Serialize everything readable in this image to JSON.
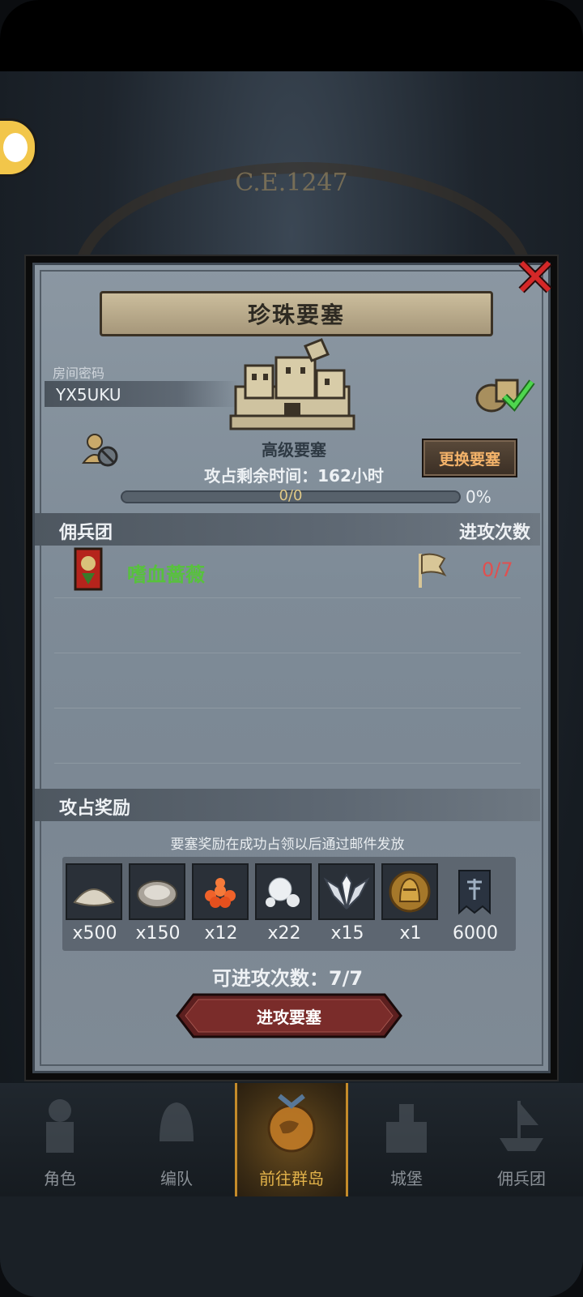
{
  "background": {
    "era_label": "C.E.1247"
  },
  "modal": {
    "title": "珍珠要塞",
    "room_password_label": "房间密码",
    "room_code": "YX5UKU",
    "fort_type": "高级要塞",
    "change_fort_button": "更换要塞",
    "remaining_time_label": "攻占剩余时间：",
    "remaining_time_value": "162",
    "remaining_time_unit": "小时",
    "progress_text": "0/0",
    "progress_percent": "0%",
    "progress_fraction": 0,
    "mercenary_section": {
      "title": "佣兵团",
      "attack_count_header": "进攻次数",
      "rows": [
        {
          "name": "嗜血蔷薇",
          "attacks": "0/7"
        }
      ]
    },
    "reward_section": {
      "title": "攻占奖励",
      "note": "要塞奖励在成功占领以后通过邮件发放",
      "items": [
        {
          "icon": "stone-pile-icon",
          "qty": "x500"
        },
        {
          "icon": "oyster-icon",
          "qty": "x150"
        },
        {
          "icon": "fish-roe-icon",
          "qty": "x12"
        },
        {
          "icon": "pearl-icon",
          "qty": "x22"
        },
        {
          "icon": "winged-emblem-icon",
          "qty": "x15"
        },
        {
          "icon": "knight-helmet-medal-icon",
          "qty": "x1"
        },
        {
          "icon": "guild-banner-icon",
          "qty": "6000"
        }
      ]
    },
    "attempts_label": "可进攻次数：",
    "attempts_value": "7/7",
    "attack_button": "进攻要塞"
  },
  "bottom_nav": [
    {
      "label": "角色",
      "icon": "knight-icon"
    },
    {
      "label": "编队",
      "icon": "helmet-icon"
    },
    {
      "label": "前往群岛",
      "icon": "island-globe-icon",
      "active": true
    },
    {
      "label": "城堡",
      "icon": "castle-icon"
    },
    {
      "label": "佣兵团",
      "icon": "ship-icon"
    }
  ],
  "colors": {
    "merc_name": "#57c23c",
    "attack_count": "#e05050",
    "change_button_text": "#f4b36a",
    "active_nav": "#e2b24a"
  }
}
